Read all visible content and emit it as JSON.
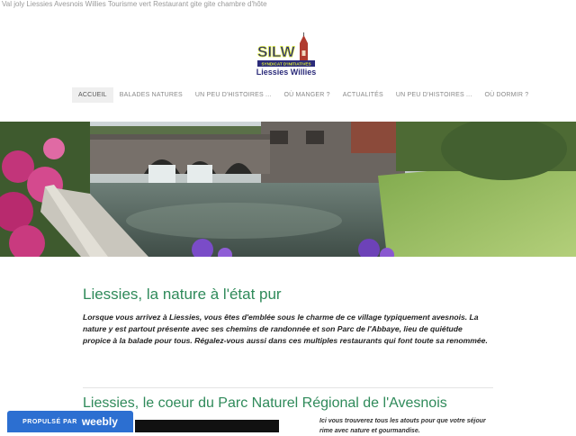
{
  "page": {
    "title": "Val joly Liessies Avesnois Willies Tourisme vert Restaurant gite gite chambre d'hôte"
  },
  "logo": {
    "main": "SILW",
    "subtitle": "SYNDICAT D'INITIATIVES",
    "name": "Liessies Willies"
  },
  "nav": {
    "items": [
      {
        "label": "ACCUEIL"
      },
      {
        "label": "BALADES NATURES"
      },
      {
        "label": "UN PEU D'HISTOIRES ..."
      },
      {
        "label": "OÙ MANGER ?"
      },
      {
        "label": "ACTUALITÉS"
      },
      {
        "label": "UN PEU D'HISTOIRES ..."
      },
      {
        "label": "OÙ DORMIR ?"
      }
    ]
  },
  "content": {
    "heading": "Liessies, la nature à l'état pur",
    "intro": "Lorsque vous arrivez à Liessies, vous êtes d'emblée sous le charme de ce village typiquement avesnois. La nature y est partout présente avec ses chemins de randonnée et son Parc de l'Abbaye, lieu de quiétude propice à la balade pour tous. Régalez-vous aussi dans ces multiples restaurants qui font toute sa renommée.",
    "heading2": "Liessies, le coeur du Parc Naturel Régional de l'Avesnois",
    "side_text": "Ici vous trouverez tous les atouts pour que votre séjour rime avec nature et gourmandise."
  },
  "weebly": {
    "prefix": "PROPULSÉ PAR",
    "brand": "weebly"
  },
  "colors": {
    "heading": "#2f8a5a",
    "weebly_blue": "#2c6fd1"
  }
}
